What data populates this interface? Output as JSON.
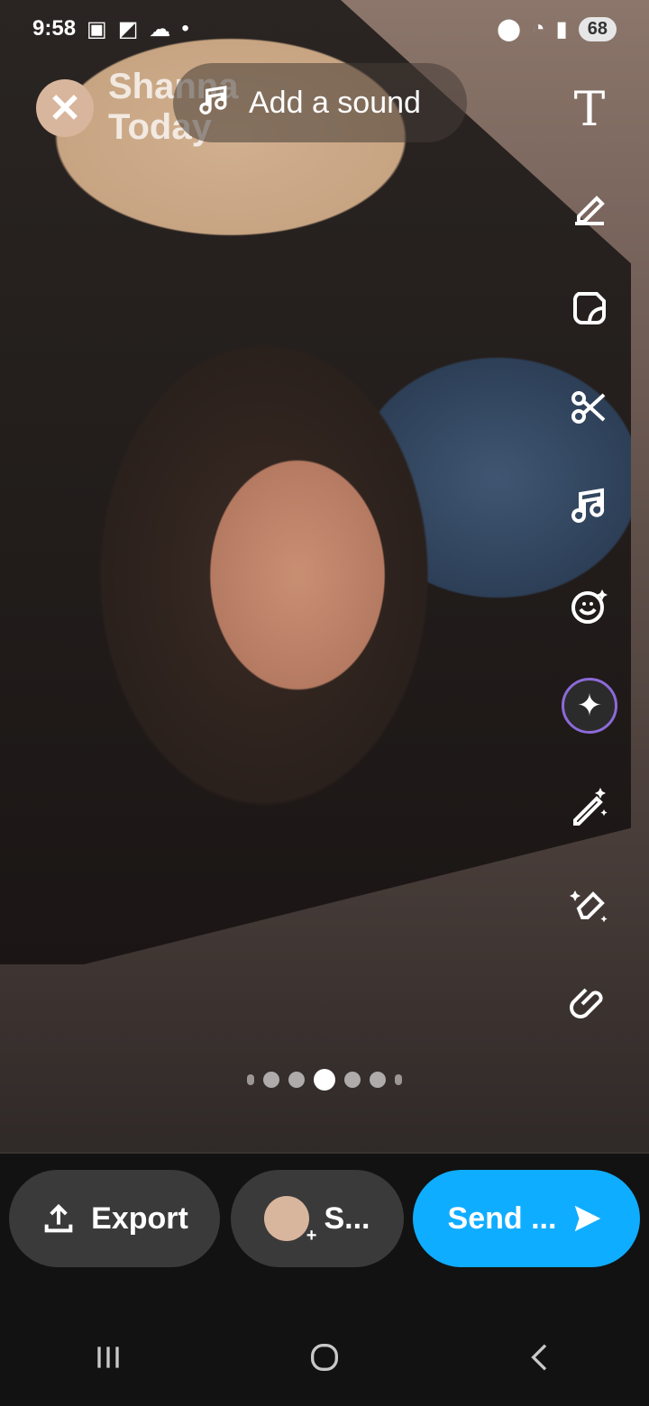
{
  "status_bar": {
    "time": "9:58",
    "battery": "68"
  },
  "snap": {
    "sender_name": "Shanna",
    "time_label": "Today"
  },
  "sound": {
    "label": "Add a sound"
  },
  "toolbar": {
    "text_tool": "T"
  },
  "bottom_actions": {
    "export_label": "Export",
    "story_label": "S...",
    "send_label": "Send ..."
  },
  "page_dots": {
    "count": 5,
    "active_index": 2
  }
}
